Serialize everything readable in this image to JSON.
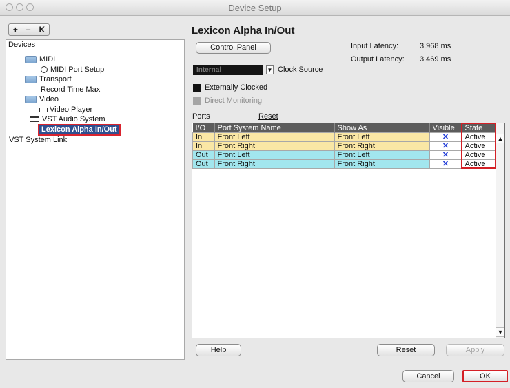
{
  "window": {
    "title": "Device Setup"
  },
  "toolbar": {
    "add": "+",
    "remove": "−",
    "reset": "K"
  },
  "devices": {
    "header": "Devices",
    "items": [
      {
        "label": "MIDI",
        "icon": "folder-icon"
      },
      {
        "label": "MIDI Port Setup",
        "icon": "midi-port-icon"
      },
      {
        "label": "Transport",
        "icon": "folder-icon"
      },
      {
        "label": "Record Time Max",
        "icon": ""
      },
      {
        "label": "Video",
        "icon": "folder-icon"
      },
      {
        "label": "Video Player",
        "icon": "video-icon"
      },
      {
        "label": "VST Audio System",
        "icon": "audio-icon"
      },
      {
        "label": "Lexicon Alpha In/Out",
        "icon": ""
      },
      {
        "label": "VST System Link",
        "icon": ""
      }
    ]
  },
  "panel": {
    "title": "Lexicon Alpha In/Out",
    "control_panel": "Control Panel",
    "input_latency_label": "Input Latency:",
    "input_latency_value": "3.968 ms",
    "output_latency_label": "Output Latency:",
    "output_latency_value": "3.469 ms",
    "clock_value": "Internal",
    "clock_label": "Clock Source",
    "externally_clocked": "Externally Clocked",
    "direct_monitoring": "Direct Monitoring",
    "ports_label": "Ports",
    "reset_link": "Reset"
  },
  "table": {
    "headers": [
      "I/O",
      "Port System Name",
      "Show As",
      "Visible",
      "State"
    ],
    "rows": [
      {
        "io": "In",
        "name": "Front Left",
        "show_as": "Front Left",
        "visible": "✕",
        "state": "Active"
      },
      {
        "io": "In",
        "name": "Front Right",
        "show_as": "Front Right",
        "visible": "✕",
        "state": "Active"
      },
      {
        "io": "Out",
        "name": "Front Left",
        "show_as": "Front Left",
        "visible": "✕",
        "state": "Active"
      },
      {
        "io": "Out",
        "name": "Front Right",
        "show_as": "Front Right",
        "visible": "✕",
        "state": "Active"
      }
    ]
  },
  "buttons": {
    "help": "Help",
    "reset": "Reset",
    "apply": "Apply",
    "cancel": "Cancel",
    "ok": "OK"
  },
  "colors": {
    "selection": "#2f4f8f",
    "highlight": "#d42026",
    "in_row": "#fae7a5",
    "out_row": "#a2e6ee"
  }
}
